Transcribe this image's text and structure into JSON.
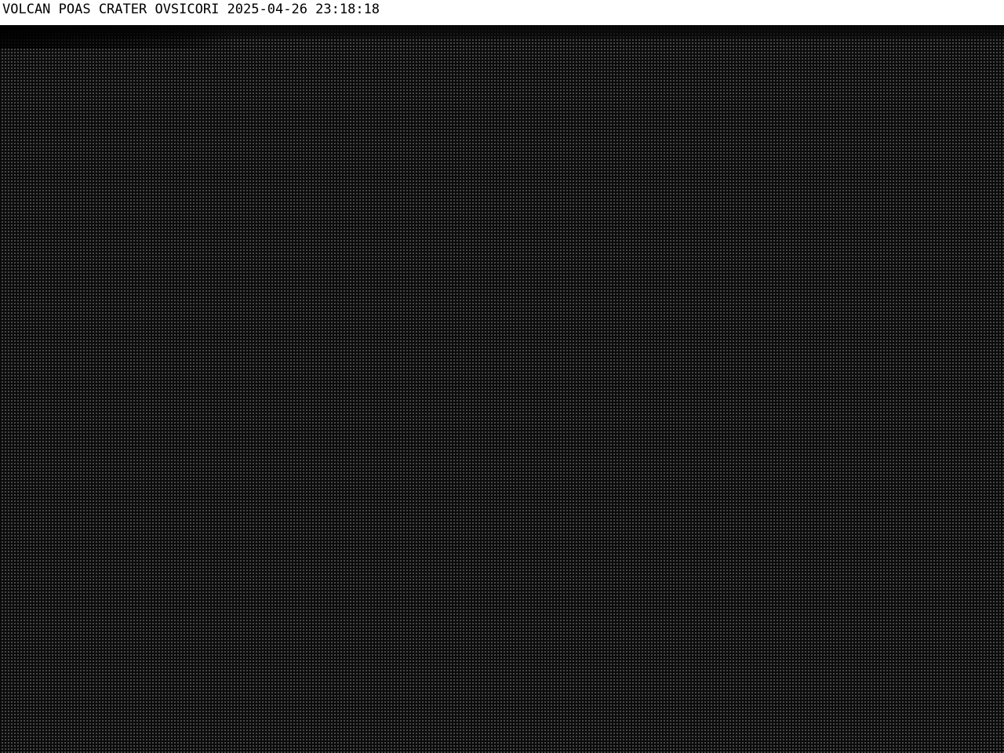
{
  "caption": {
    "text": "VOLCAN POAS CRATER OVSICORI 2025-04-26 23:18:18"
  },
  "colors": {
    "caption_background": "#ffffff",
    "caption_text": "#000000",
    "image_background": "#0b0b0b"
  }
}
